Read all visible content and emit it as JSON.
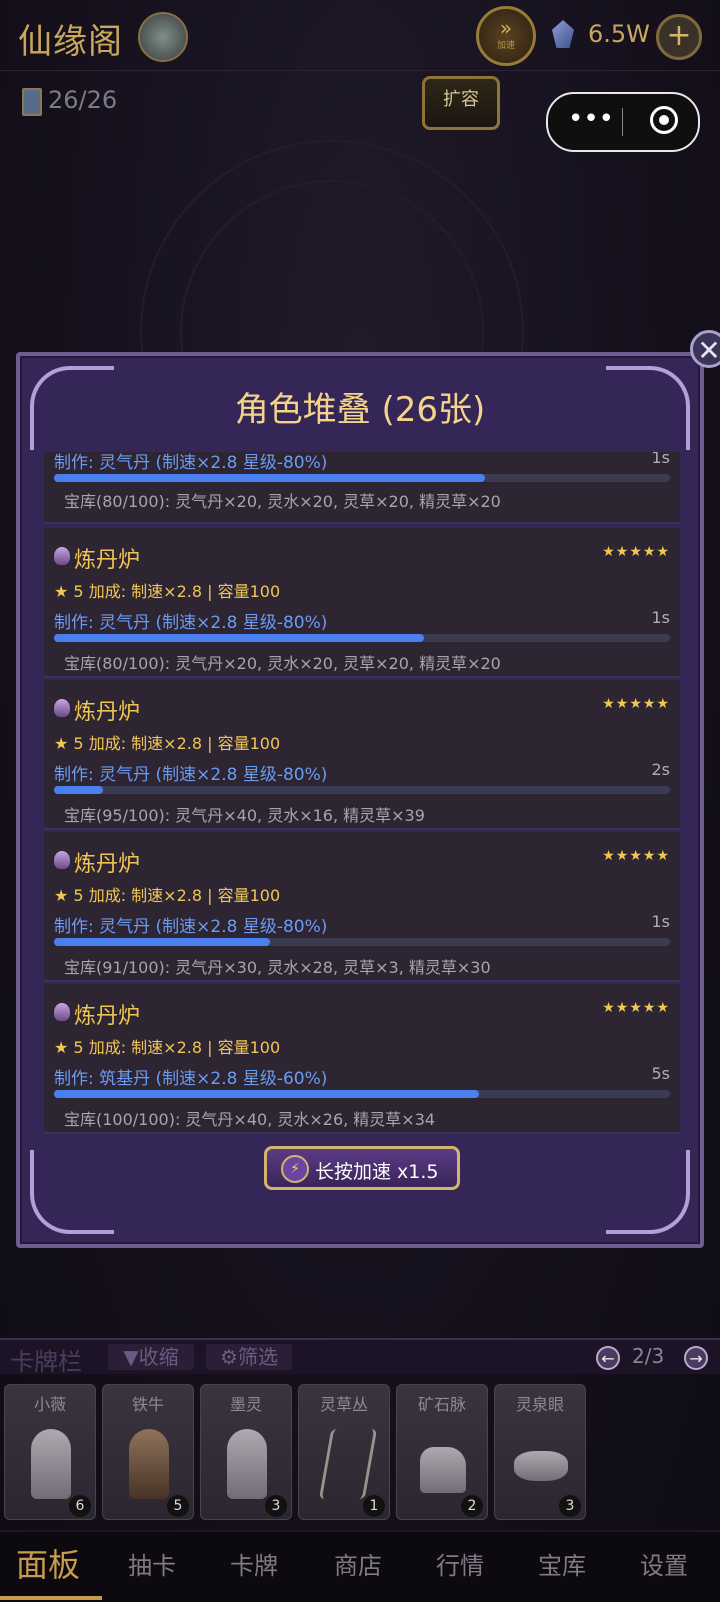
{
  "header": {
    "app_title": "仙缘阁",
    "currency": "6.5W",
    "deck_count": "26/26",
    "expand_label": "扩容",
    "fast_forward_label": "加速"
  },
  "modal": {
    "title": "角色堆叠 (26张)",
    "speed_label": "长按加速 x1.5",
    "items": [
      {
        "name": "",
        "stars": "",
        "bonus": "",
        "craft": "制作: 灵气丹 (制速×2.8 星级-80%)",
        "time": "1s",
        "progress": 0.7,
        "store": "宝库(80/100): 灵气丹×20, 灵水×20, 灵草×20, 精灵草×20"
      },
      {
        "name": "炼丹炉",
        "stars": "★★★★★",
        "bonus": "★ 5 加成: 制速×2.8 | 容量100",
        "craft": "制作: 灵气丹 (制速×2.8 星级-80%)",
        "time": "1s",
        "progress": 0.6,
        "store": "宝库(80/100): 灵气丹×20, 灵水×20, 灵草×20, 精灵草×20"
      },
      {
        "name": "炼丹炉",
        "stars": "★★★★★",
        "bonus": "★ 5 加成: 制速×2.8 | 容量100",
        "craft": "制作: 灵气丹 (制速×2.8 星级-80%)",
        "time": "2s",
        "progress": 0.08,
        "store": "宝库(95/100): 灵气丹×40, 灵水×16, 精灵草×39"
      },
      {
        "name": "炼丹炉",
        "stars": "★★★★★",
        "bonus": "★ 5 加成: 制速×2.8 | 容量100",
        "craft": "制作: 灵气丹 (制速×2.8 星级-80%)",
        "time": "1s",
        "progress": 0.35,
        "store": "宝库(91/100): 灵气丹×30, 灵水×28, 灵草×3, 精灵草×30"
      },
      {
        "name": "炼丹炉",
        "stars": "★★★★★",
        "bonus": "★ 5 加成: 制速×2.8 | 容量100",
        "craft": "制作: 筑基丹 (制速×2.8 星级-60%)",
        "time": "5s",
        "progress": 0.69,
        "store": "宝库(100/100): 灵气丹×40, 灵水×26, 精灵草×34"
      }
    ]
  },
  "cardbar": {
    "title": "卡牌栏",
    "collapse_label": "▼收缩",
    "filter_label": "⚙筛选",
    "page": "2/3",
    "cards": [
      {
        "name": "小薇",
        "count": "6"
      },
      {
        "name": "铁牛",
        "count": "5"
      },
      {
        "name": "墨灵",
        "count": "3"
      },
      {
        "name": "灵草丛",
        "count": "1"
      },
      {
        "name": "矿石脉",
        "count": "2"
      },
      {
        "name": "灵泉眼",
        "count": "3"
      }
    ]
  },
  "nav": {
    "items": [
      "面板",
      "抽卡",
      "卡牌",
      "商店",
      "行情",
      "宝库",
      "设置"
    ],
    "active": "面板"
  },
  "colors": {
    "accent_gold": "#f0c653",
    "progress_blue": "#4a7ff0",
    "modal_purple": "#352658"
  }
}
